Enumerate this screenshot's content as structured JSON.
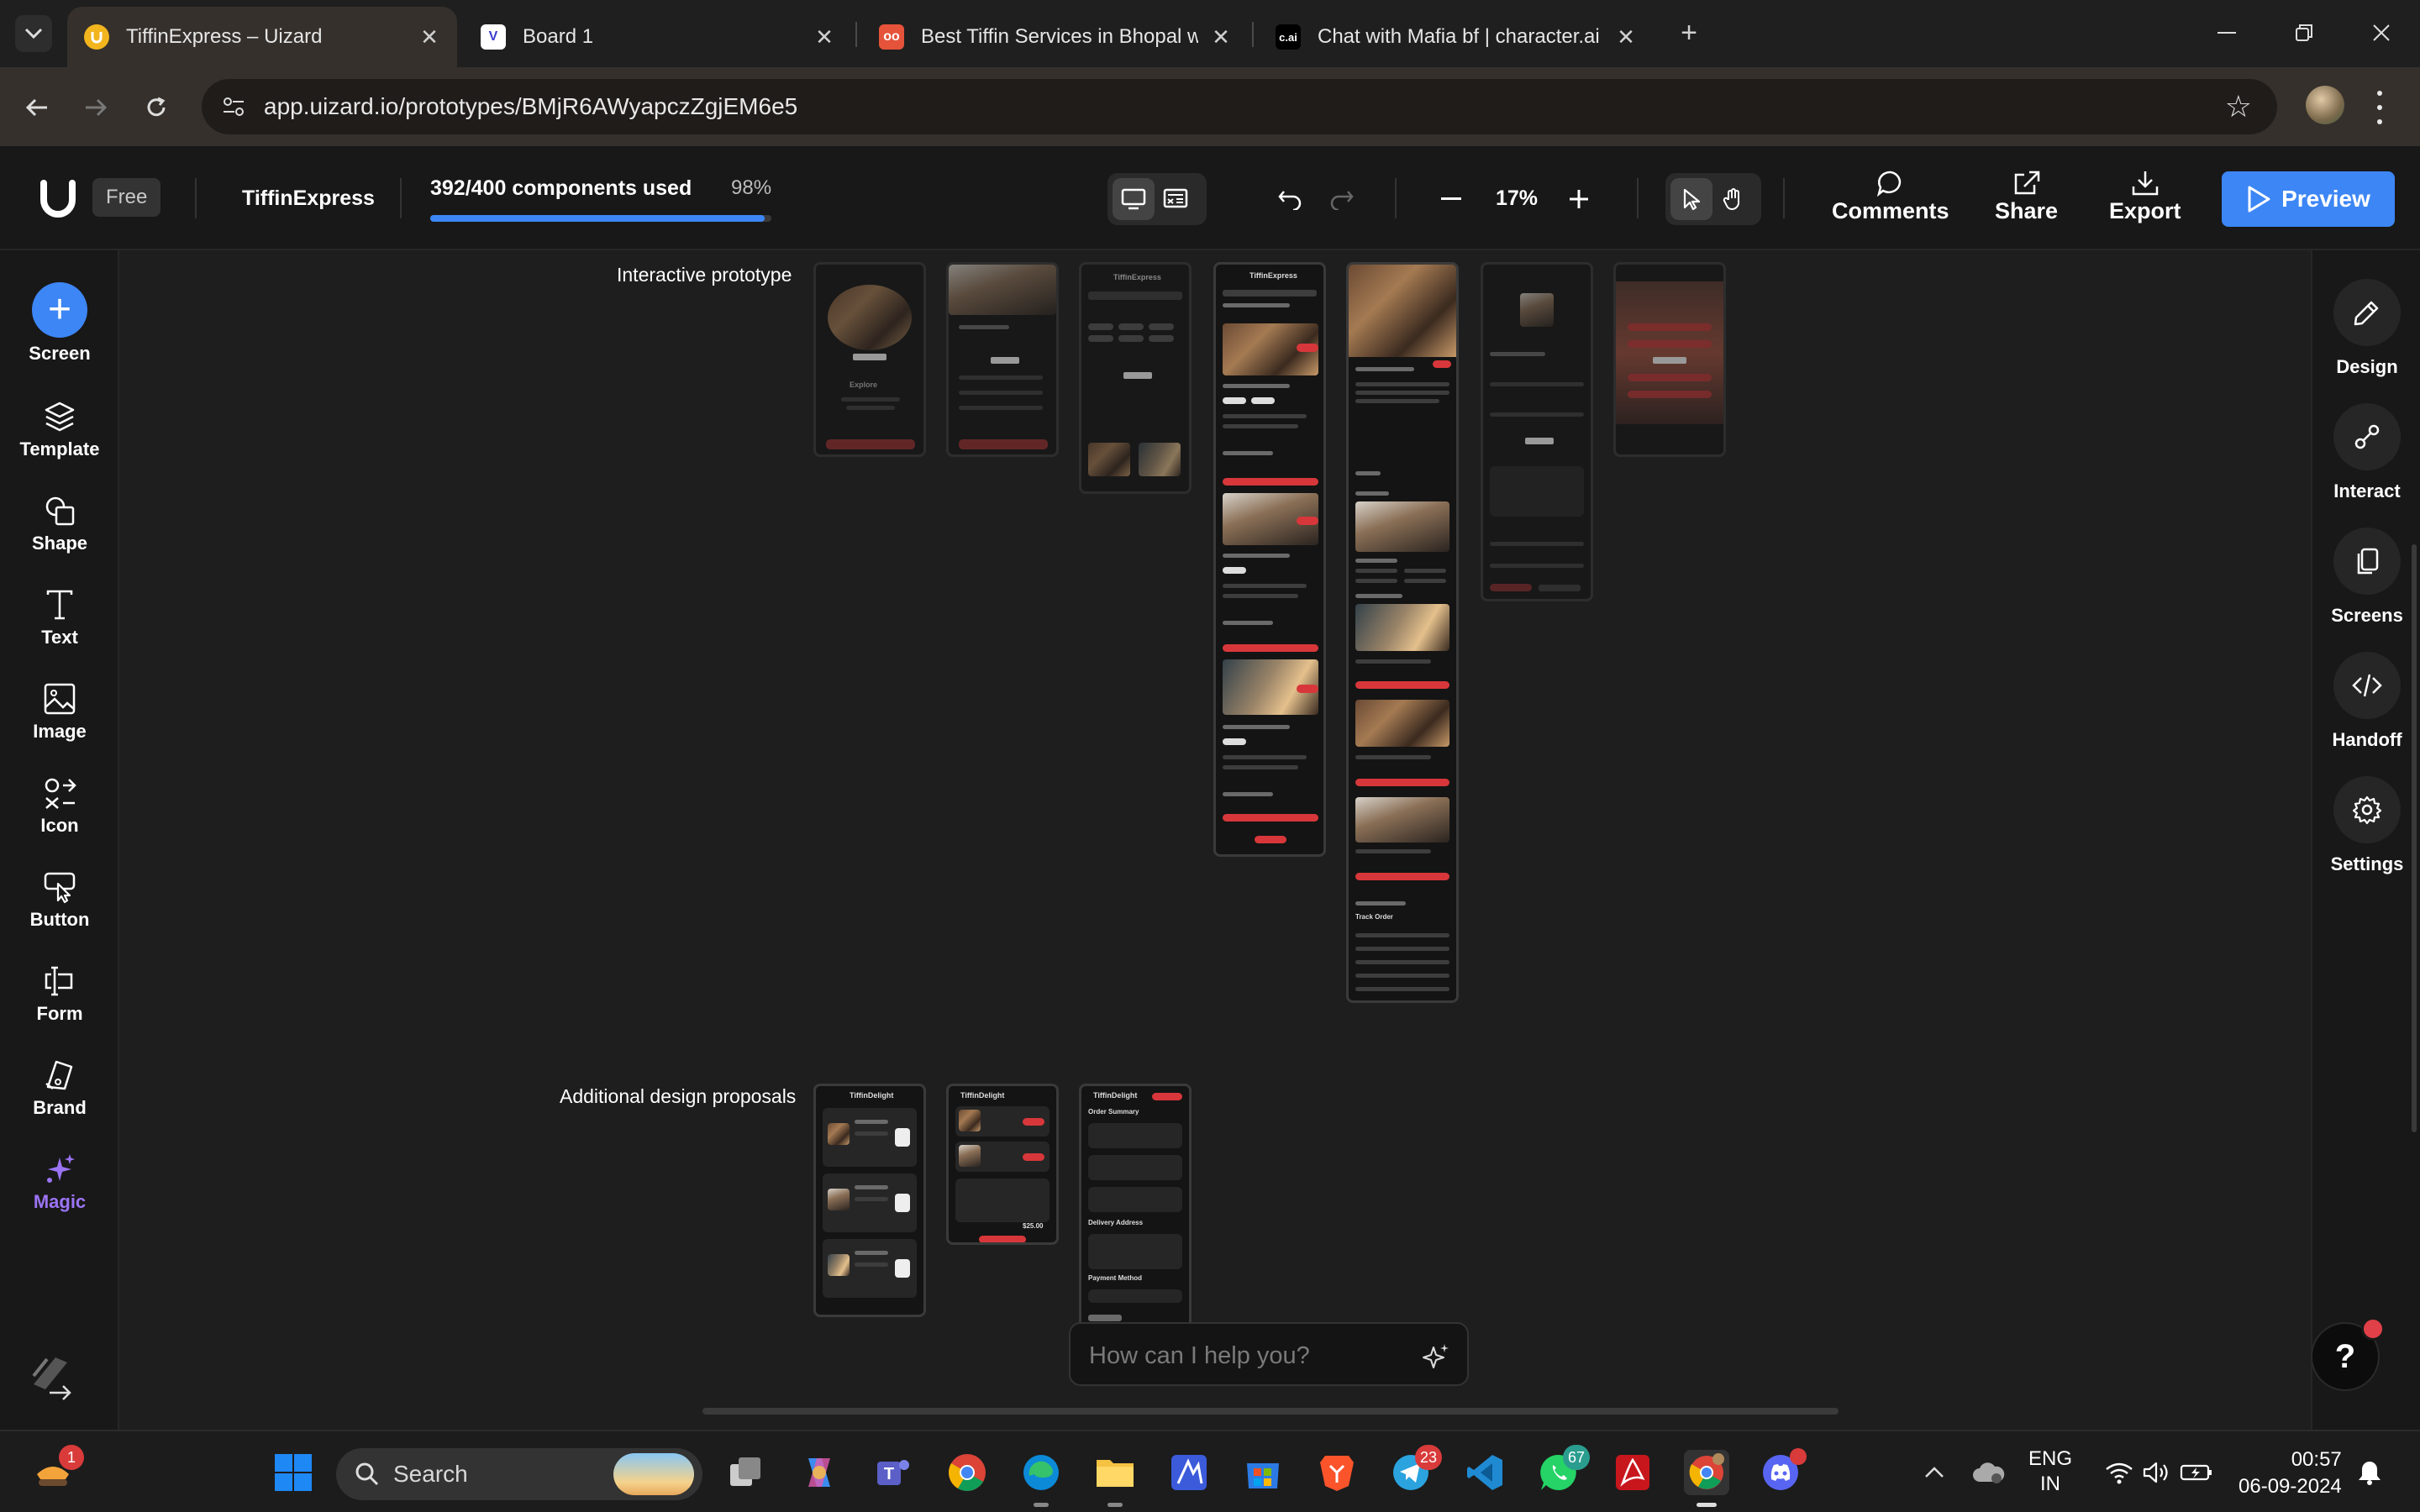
{
  "browser": {
    "tabs": [
      {
        "title": "TiffinExpress – Uizard",
        "favicon": "uizard-icon",
        "active": true
      },
      {
        "title": "Board 1",
        "favicon": "board-icon",
        "active": false
      },
      {
        "title": "Best Tiffin Services in Bhopal wi",
        "favicon": "zomato-style-icon",
        "active": false
      },
      {
        "title": "Chat with Mafia bf | character.ai",
        "favicon": "characterai-icon",
        "active": false
      }
    ],
    "url": "app.uizard.io/prototypes/BMjR6AWyapczZgjEM6e5"
  },
  "toolbar": {
    "plan": "Free",
    "project_name": "TiffinExpress",
    "usage_label": "392/400 components used",
    "usage_percent": "98%",
    "usage_fraction": 0.98,
    "zoom": "17%",
    "comments_label": "Comments",
    "share_label": "Share",
    "export_label": "Export",
    "preview_label": "Preview"
  },
  "left_sidebar": {
    "items": [
      "Screen",
      "Template",
      "Shape",
      "Text",
      "Image",
      "Icon",
      "Button",
      "Form",
      "Brand",
      "Magic"
    ]
  },
  "right_sidebar": {
    "items": [
      "Design",
      "Interact",
      "Screens",
      "Handoff",
      "Settings"
    ]
  },
  "canvas": {
    "sections": [
      "Interactive prototype",
      "Additional design proposals"
    ],
    "mock_texts": {
      "explore": "Explore",
      "app_name": "TiffinExpress",
      "delight": "TiffinDelight",
      "order_summary": "Order Summary",
      "delivery_address": "Delivery Address",
      "payment_method": "Payment Method",
      "track_order": "Track Order",
      "total": "$25.00"
    },
    "chat_placeholder": "How can I help you?"
  },
  "taskbar": {
    "search_label": "Search",
    "language": "ENG",
    "region": "IN",
    "time": "00:57",
    "date": "06-09-2024",
    "badges": {
      "weather": "1",
      "telegram": "23",
      "whatsapp": "67"
    }
  },
  "colors": {
    "accent": "#3d86f5",
    "magic": "#9b74f5",
    "mock_red": "#d7373a"
  }
}
